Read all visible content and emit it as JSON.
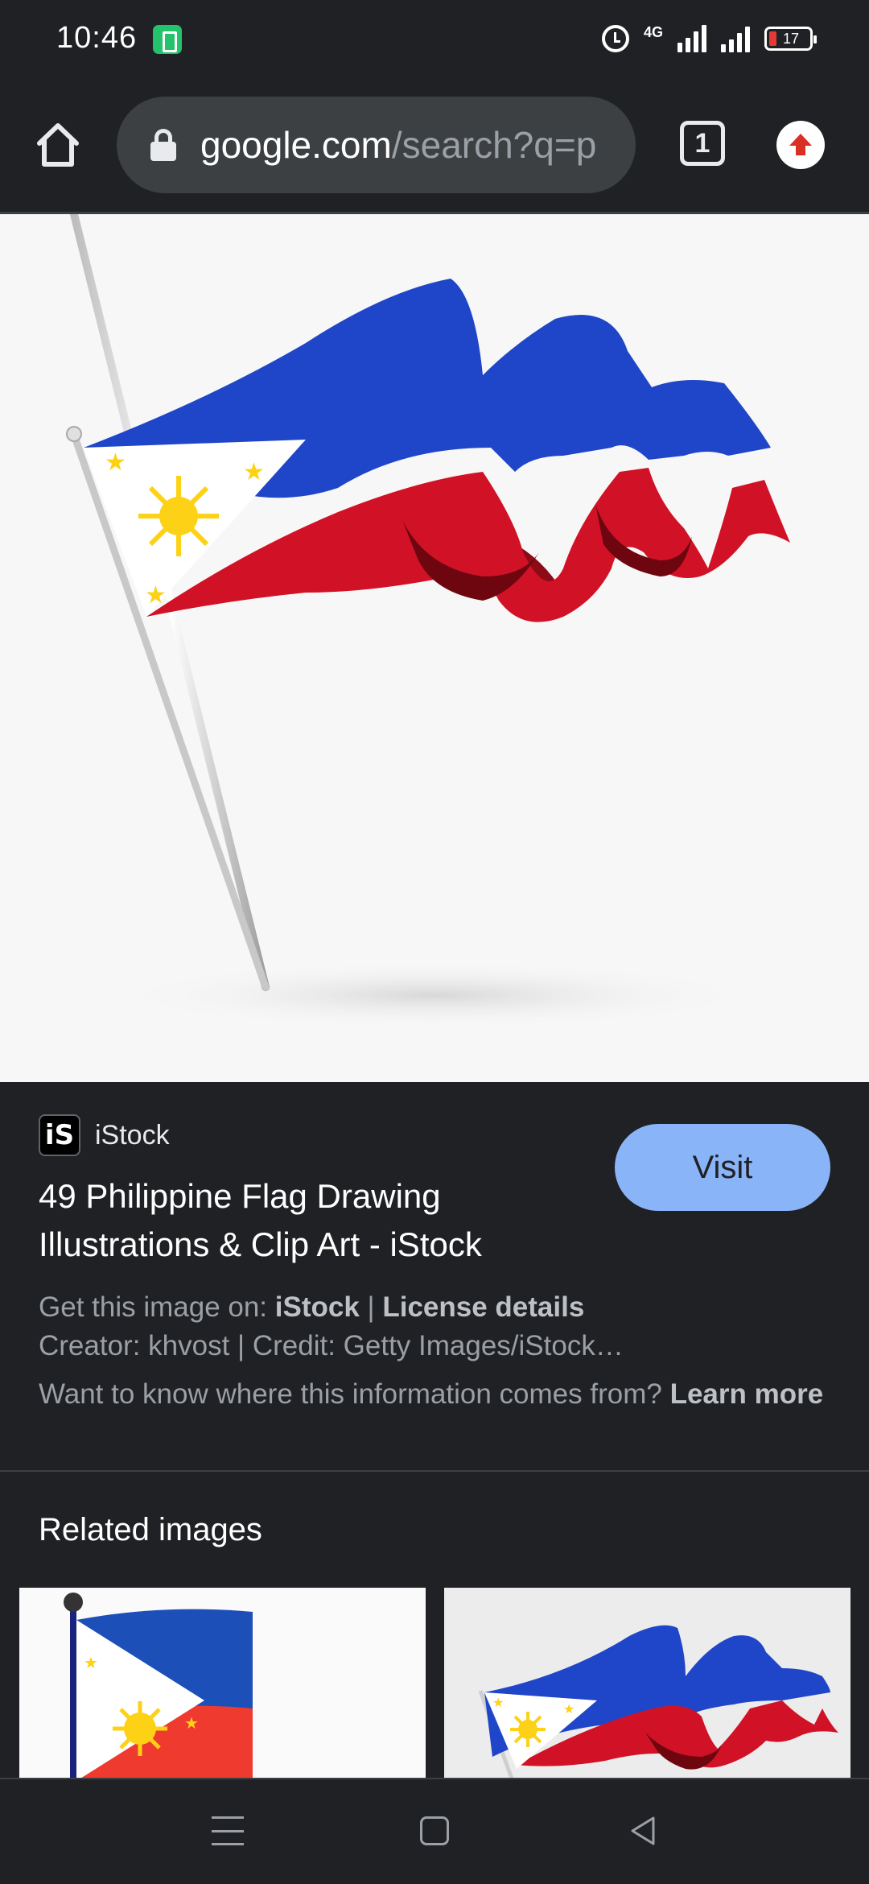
{
  "status_bar": {
    "time": "10:46",
    "network": "4G",
    "battery": "17",
    "icons": [
      "battery-saver-icon",
      "alarm-icon",
      "signal-icon",
      "battery-icon"
    ]
  },
  "toolbar": {
    "url_domain": "google.com",
    "url_path": "/search?q=p",
    "tab_count": "1",
    "icons": [
      "home-icon",
      "lock-icon",
      "tabs-icon",
      "update-icon"
    ]
  },
  "main_image": {
    "icon": "philippine-flag-image"
  },
  "result": {
    "source_logo": "iS",
    "source_name": "iStock",
    "visit_label": "Visit",
    "title": "49 Philippine Flag Drawing Illustrations & Clip Art - iStock",
    "get_image_prefix": "Get this image on: ",
    "get_image_source": "iStock",
    "separator": " | ",
    "license_label": "License details",
    "creator_line": "Creator: khvost | Credit: Getty Images/iStock…",
    "info_question": "Want to know where this information comes from? ",
    "learn_more": "Learn more"
  },
  "related": {
    "title": "Related images"
  },
  "colors": {
    "background": "#202124",
    "accent": "#8ab4f8",
    "flag_blue": "#0038a8",
    "flag_red": "#ce1126",
    "flag_yellow": "#fcd116"
  },
  "nav": {
    "icons": [
      "menu-icon",
      "home-square-icon",
      "back-icon"
    ]
  }
}
